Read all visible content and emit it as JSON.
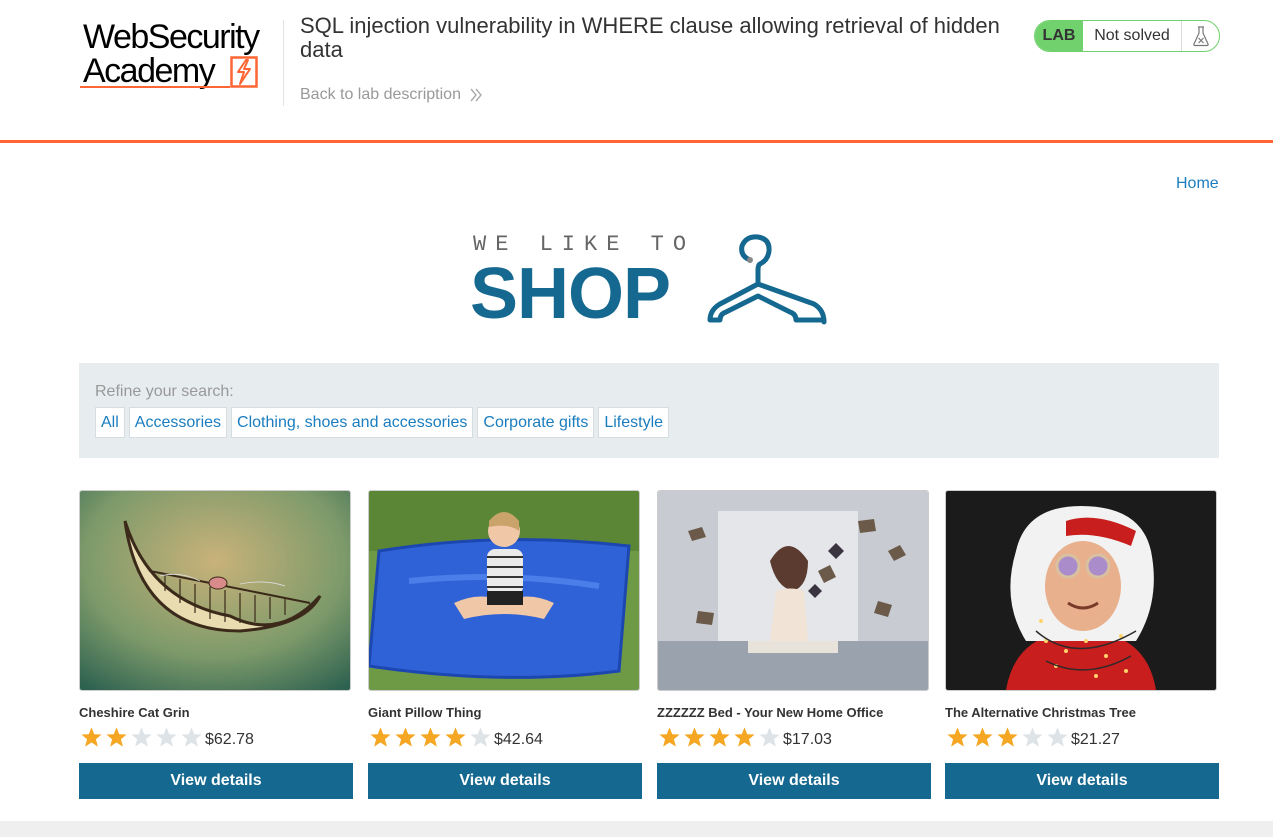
{
  "header": {
    "logo": {
      "line1": "WebSecurity",
      "line2": "Academy"
    },
    "lab_title": "SQL injection vulnerability in WHERE clause allowing retrieval of hidden data",
    "back_link": "Back to lab description",
    "badge": {
      "lab": "LAB",
      "status": "Not solved",
      "icon": "flask-icon"
    }
  },
  "nav": {
    "home": "Home"
  },
  "shop_logo": {
    "tagline": "WE LIKE TO",
    "word": "SHOP",
    "icon": "hanger-icon"
  },
  "filters": {
    "label": "Refine your search:",
    "categories": [
      "All",
      "Accessories",
      "Clothing, shoes and accessories",
      "Corporate gifts",
      "Lifestyle"
    ]
  },
  "products": [
    {
      "name": "Cheshire Cat Grin",
      "rating": 2,
      "price": "$62.78",
      "button": "View details"
    },
    {
      "name": "Giant Pillow Thing",
      "rating": 4,
      "price": "$42.64",
      "button": "View details"
    },
    {
      "name": "ZZZZZZ Bed - Your New Home Office",
      "rating": 4,
      "price": "$17.03",
      "button": "View details"
    },
    {
      "name": "The Alternative Christmas Tree",
      "rating": 3,
      "price": "$21.27",
      "button": "View details"
    }
  ],
  "colors": {
    "accent_orange": "#ff6633",
    "brand_blue": "#15688f",
    "link_blue": "#1a7dbf",
    "badge_green": "#70d16d",
    "star_gold": "#f5a623",
    "star_empty": "#dde3e7"
  }
}
